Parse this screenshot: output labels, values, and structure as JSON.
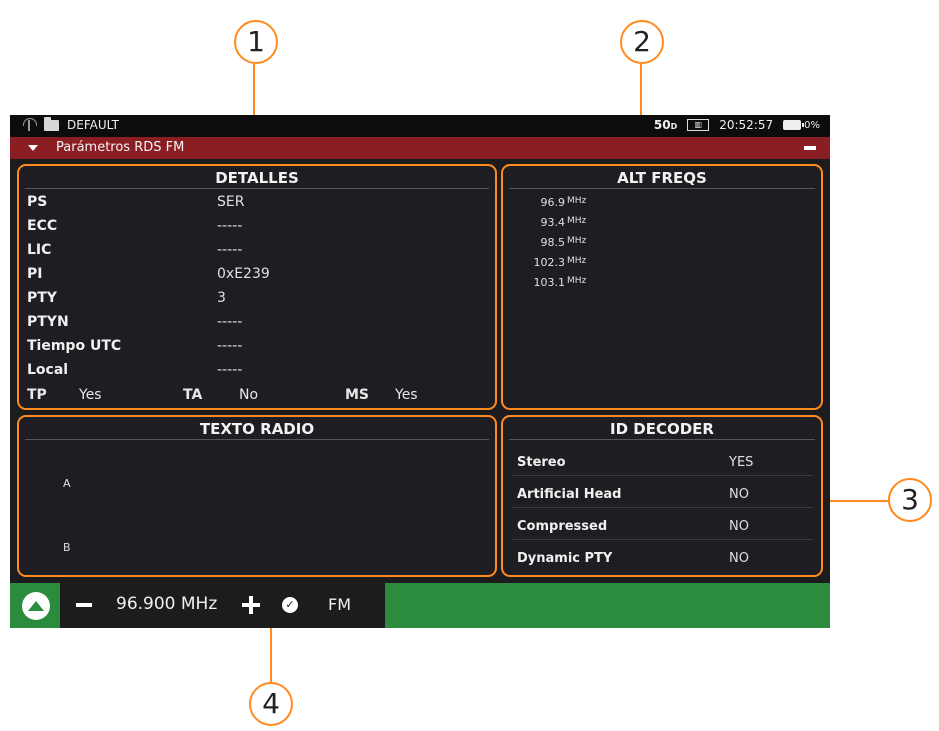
{
  "statusbar": {
    "profile": "DEFAULT",
    "signal": "50",
    "signal_unit": "D",
    "time": "20:52:57",
    "battery": "0%"
  },
  "titlebar": {
    "title": "Parámetros RDS FM"
  },
  "detalles": {
    "title": "DETALLES",
    "rows": [
      {
        "label": "PS",
        "value": "SER"
      },
      {
        "label": "ECC",
        "value": "-----"
      },
      {
        "label": "LIC",
        "value": "-----"
      },
      {
        "label": "PI",
        "value": "0xE239"
      },
      {
        "label": "PTY",
        "value": "3"
      },
      {
        "label": "PTYN",
        "value": "-----"
      },
      {
        "label": "Tiempo UTC",
        "value": "-----"
      },
      {
        "label": "Local",
        "value": "-----"
      }
    ],
    "flags": {
      "tp_label": "TP",
      "tp_value": "Yes",
      "ta_label": "TA",
      "ta_value": "No",
      "ms_label": "MS",
      "ms_value": "Yes"
    }
  },
  "alt_freqs": {
    "title": "ALT FREQS",
    "unit": "MHz",
    "items": [
      "96.9",
      "93.4",
      "98.5",
      "102.3",
      "103.1"
    ]
  },
  "texto_radio": {
    "title": "TEXTO RADIO",
    "label_a": "A",
    "label_b": "B"
  },
  "id_decoder": {
    "title": "ID DECODER",
    "rows": [
      {
        "label": "Stereo",
        "value": "YES"
      },
      {
        "label": "Artificial Head",
        "value": "NO"
      },
      {
        "label": "Compressed",
        "value": "NO"
      },
      {
        "label": "Dynamic PTY",
        "value": "NO"
      }
    ]
  },
  "bottom": {
    "frequency": "96.900 MHz",
    "band": "FM"
  },
  "callouts": [
    "1",
    "2",
    "3",
    "4"
  ],
  "colors": {
    "accent": "#ff8a1f",
    "titlebar": "#8b1e22",
    "bottombar": "#2a8c3c",
    "screen_bg": "#1c1c1f"
  }
}
